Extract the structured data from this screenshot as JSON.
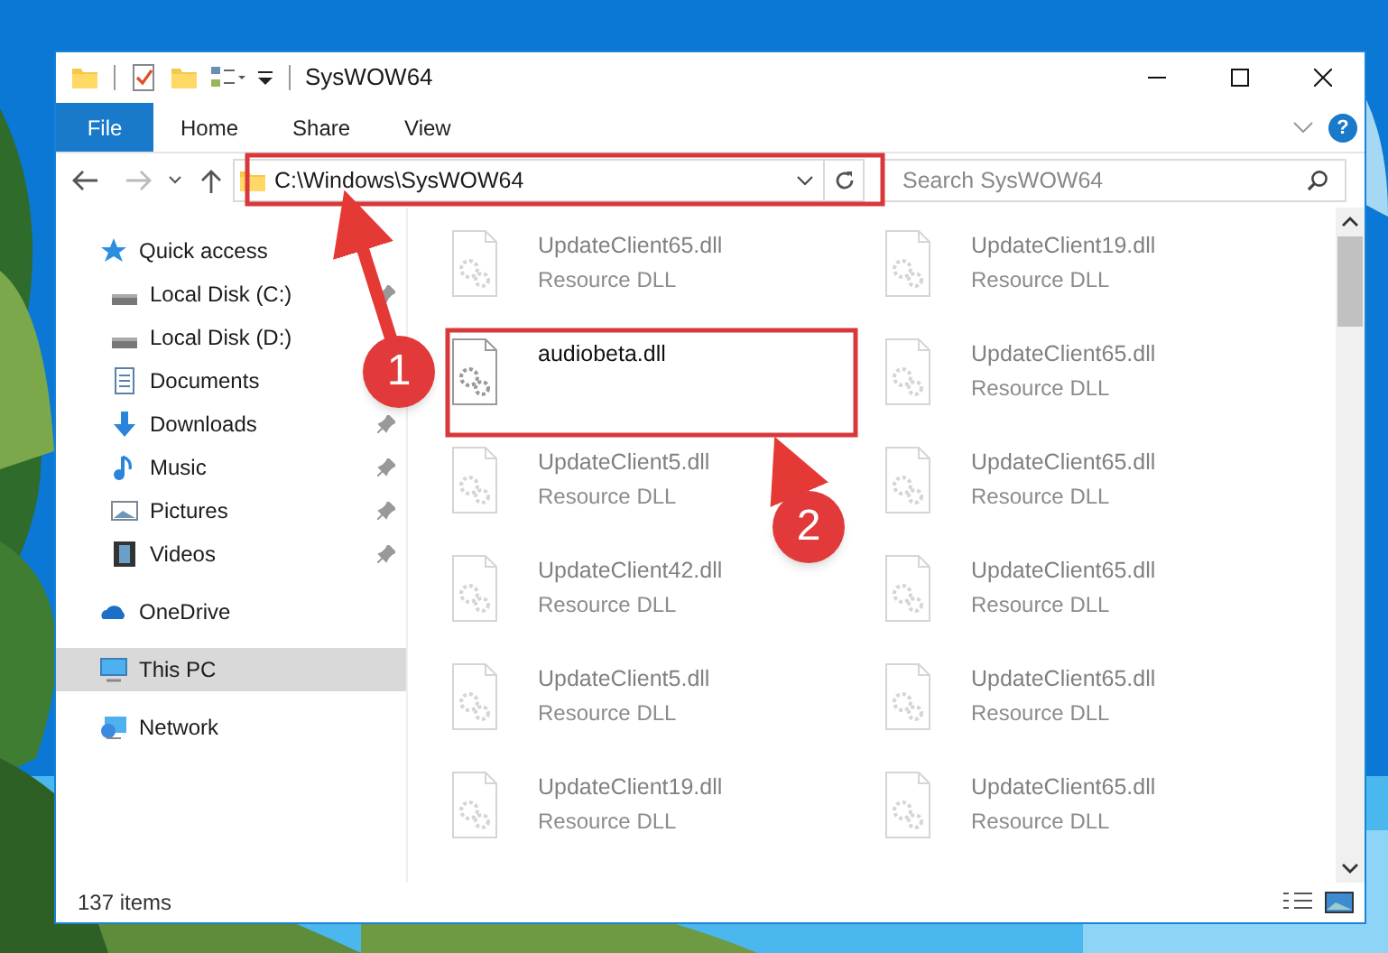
{
  "window": {
    "title": "SysWOW64"
  },
  "ribbon": {
    "tabs": [
      {
        "label": "File",
        "selected": true
      },
      {
        "label": "Home",
        "selected": false
      },
      {
        "label": "Share",
        "selected": false
      },
      {
        "label": "View",
        "selected": false
      }
    ],
    "help": "?"
  },
  "address_bar": {
    "path": "C:\\Windows\\SysWOW64"
  },
  "search": {
    "placeholder": "Search SysWOW64"
  },
  "sidebar": {
    "items": [
      {
        "label": "Quick access",
        "kind": "star",
        "selected": false,
        "pinned": false,
        "children": [
          {
            "label": "Local Disk (C:)",
            "kind": "drive",
            "selected": false,
            "pinned": true
          },
          {
            "label": "Local Disk (D:)",
            "kind": "drive",
            "selected": false,
            "pinned": false
          },
          {
            "label": "Documents",
            "kind": "documents",
            "selected": false,
            "pinned": false
          },
          {
            "label": "Downloads",
            "kind": "downloads",
            "selected": false,
            "pinned": true
          },
          {
            "label": "Music",
            "kind": "music",
            "selected": false,
            "pinned": true
          },
          {
            "label": "Pictures",
            "kind": "pictures",
            "selected": false,
            "pinned": true
          },
          {
            "label": "Videos",
            "kind": "videos",
            "selected": false,
            "pinned": true
          }
        ]
      },
      {
        "label": "OneDrive",
        "kind": "cloud",
        "selected": false,
        "pinned": false
      },
      {
        "label": "This PC",
        "kind": "pc",
        "selected": true,
        "pinned": false
      },
      {
        "label": "Network",
        "kind": "network",
        "selected": false,
        "pinned": false
      }
    ]
  },
  "files": [
    {
      "name": "UpdateClient65.dll",
      "type": "Resource DLL",
      "blurred": true
    },
    {
      "name": "UpdateClient19.dll",
      "type": "Resource DLL",
      "blurred": true
    },
    {
      "name": "audiobeta.dll",
      "blurred": false
    },
    {
      "name": "UpdateClient65.dll",
      "type": "Resource DLL",
      "blurred": true
    },
    {
      "name": "UpdateClient5.dll",
      "type": "Resource DLL",
      "blurred": true
    },
    {
      "name": "UpdateClient65.dll",
      "type": "Resource DLL",
      "blurred": true
    },
    {
      "name": "UpdateClient42.dll",
      "type": "Resource DLL",
      "blurred": true
    },
    {
      "name": "UpdateClient65.dll",
      "type": "Resource DLL",
      "blurred": true
    },
    {
      "name": "UpdateClient5.dll",
      "type": "Resource DLL",
      "blurred": true
    },
    {
      "name": "UpdateClient65.dll",
      "type": "Resource DLL",
      "blurred": true
    },
    {
      "name": "UpdateClient19.dll",
      "type": "Resource DLL",
      "blurred": true
    },
    {
      "name": "UpdateClient65.dll",
      "type": "Resource DLL",
      "blurred": true
    }
  ],
  "status_bar": {
    "item_count": "137 items"
  },
  "annotations": [
    {
      "number": "1"
    },
    {
      "number": "2"
    }
  ]
}
